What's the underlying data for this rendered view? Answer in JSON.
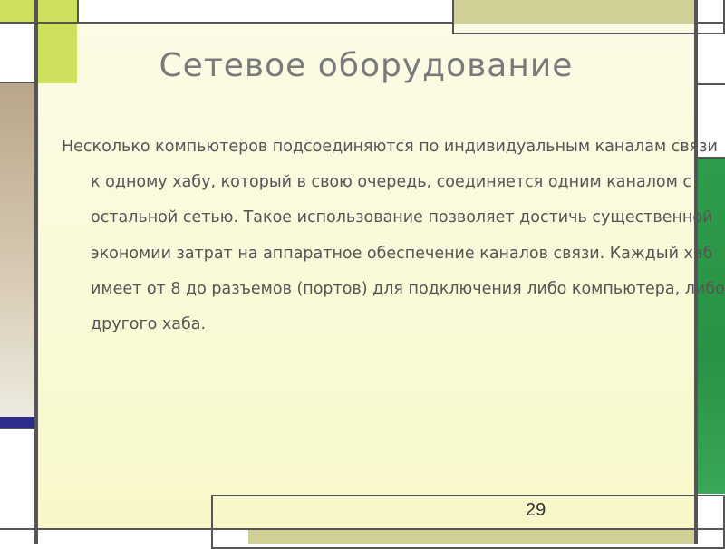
{
  "slide": {
    "title": "Сетевое оборудование",
    "body": "Несколько компьютеров подсоединяются по индивидуальным каналам связи к одному хабу, который в свою очередь, соединяется одним каналом с остальной сетью. Такое использование позволяет достичь существенной экономии затрат на аппаратное обеспечение каналов связи. Каждый хаб имеет от 8 до разъемов (портов) для подключения либо компьютера, либо другого хаба.",
    "page_number": "29"
  },
  "colors": {
    "accent_green_light": "#cfe05e",
    "accent_olive": "#cfcf96",
    "accent_tan": "#bba98d",
    "accent_navy": "#2d2d8a",
    "accent_green_dark": "#2e9c4a",
    "background_cream": "#fafad6"
  }
}
